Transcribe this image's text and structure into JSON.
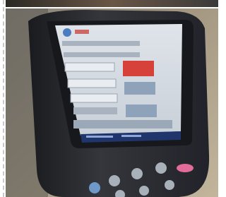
{
  "colors": {
    "background": "#ffffff",
    "dashed_border": "#c9c9c9",
    "device_body": "#2a2c31",
    "screen_bezel": "#1c1d21",
    "screen_bg": "#d7dde4",
    "red_button": "#d6423a",
    "blue_fields": "#8ea3ba",
    "taskbar": "#20356b",
    "pink_key": "#e46c9a",
    "grey_keys": "#a8b0ba",
    "top_strip": "#3b3730",
    "right_background": "#b8ab93"
  },
  "photo": {
    "subject": "handheld-device"
  }
}
